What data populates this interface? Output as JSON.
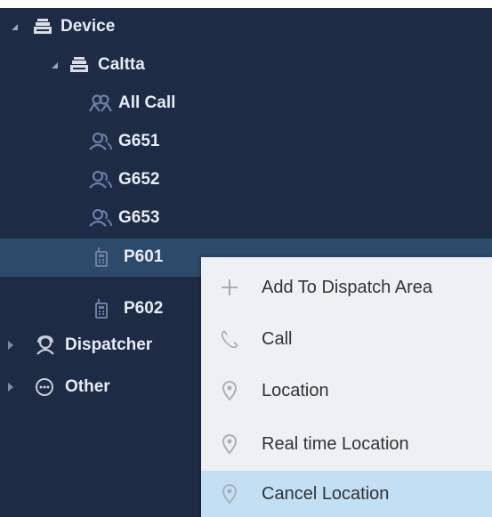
{
  "tree": {
    "device": {
      "label": "Device",
      "icon": "device-server-icon"
    },
    "caltta": {
      "label": "Caltta",
      "icon": "device-server-icon"
    },
    "groups": [
      {
        "label": "All Call",
        "icon": "all-call-group-icon"
      },
      {
        "label": "G651",
        "icon": "group-icon"
      },
      {
        "label": "G652",
        "icon": "group-icon"
      },
      {
        "label": "G653",
        "icon": "group-icon"
      }
    ],
    "radios": [
      {
        "label": "P601",
        "icon": "radio-terminal-icon",
        "selected": true
      },
      {
        "label": "P602",
        "icon": "radio-terminal-icon",
        "selected": false
      }
    ],
    "dispatcher": {
      "label": "Dispatcher",
      "icon": "dispatcher-icon"
    },
    "other": {
      "label": "Other",
      "icon": "more-options-icon"
    }
  },
  "context_menu": {
    "items": [
      {
        "label": "Add To Dispatch Area",
        "icon": "plus-icon"
      },
      {
        "label": "Call",
        "icon": "phone-icon"
      },
      {
        "label": "Location",
        "icon": "location-pin-icon"
      },
      {
        "label": "Real time Location",
        "icon": "location-pin-icon"
      },
      {
        "label": "Cancel Location",
        "icon": "location-pin-icon",
        "hovered": true
      }
    ]
  },
  "colors": {
    "tree_background": "#1d2b45",
    "selected_row": "#2c4a69",
    "menu_background": "#eef0f2",
    "menu_hover": "#c2dff4",
    "group_icon": "#6b7fa8"
  }
}
